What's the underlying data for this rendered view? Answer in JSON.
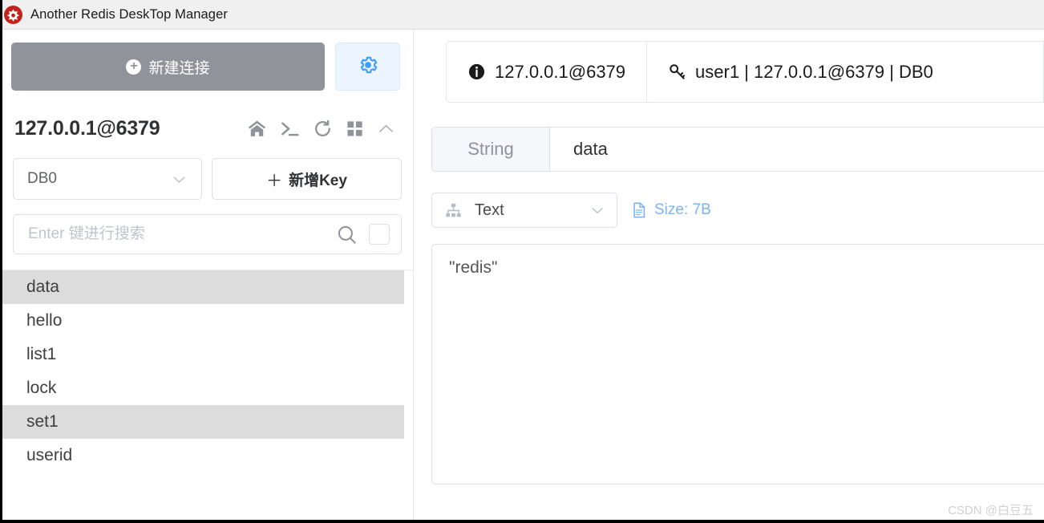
{
  "titlebar": {
    "title": "Another Redis DeskTop Manager",
    "logo_icon": "redis-logo-icon"
  },
  "sidebar": {
    "new_connection": {
      "label": "新建连接",
      "icon": "plus-circle-icon",
      "bg_color": "#909399",
      "text_color": "#ffffff"
    },
    "settings_button": {
      "icon": "gear-icon",
      "bg_color": "#ecf5ff",
      "icon_color": "#409eff"
    },
    "connection": {
      "name": "127.0.0.1@6379",
      "toolbar_icons": [
        "home-icon",
        "terminal-icon",
        "refresh-icon",
        "grid-icon",
        "chevron-up-icon"
      ]
    },
    "db_select": {
      "value": "DB0",
      "chevron_icon": "chevron-down-icon"
    },
    "add_key": {
      "plus": "＋",
      "label": "新增Key"
    },
    "search": {
      "value": "",
      "placeholder": "Enter 键进行搜索",
      "icon": "search-icon",
      "checkbox_icon": "checkbox-icon"
    },
    "keys": [
      {
        "name": "data",
        "selected": true
      },
      {
        "name": "hello",
        "selected": false
      },
      {
        "name": "list1",
        "selected": false
      },
      {
        "name": "lock",
        "selected": false
      },
      {
        "name": "set1",
        "selected": true
      },
      {
        "name": "userid",
        "selected": false
      }
    ]
  },
  "main": {
    "tabs": [
      {
        "label": "127.0.0.1@6379",
        "icon": "info-icon",
        "active": false
      },
      {
        "label": "user1 | 127.0.0.1@6379 | DB0",
        "icon": "key-icon",
        "active": true
      }
    ],
    "key_header": {
      "type": "String",
      "name": "data"
    },
    "format": {
      "value": "Text",
      "icon": "sitemap-icon",
      "chevron_icon": "chevron-down-icon"
    },
    "size": {
      "label": "Size: 7B",
      "icon": "document-icon",
      "color": "#7eb3f5"
    },
    "value": "\"redis\""
  },
  "watermark": {
    "text": "CSDN @白豆五"
  }
}
